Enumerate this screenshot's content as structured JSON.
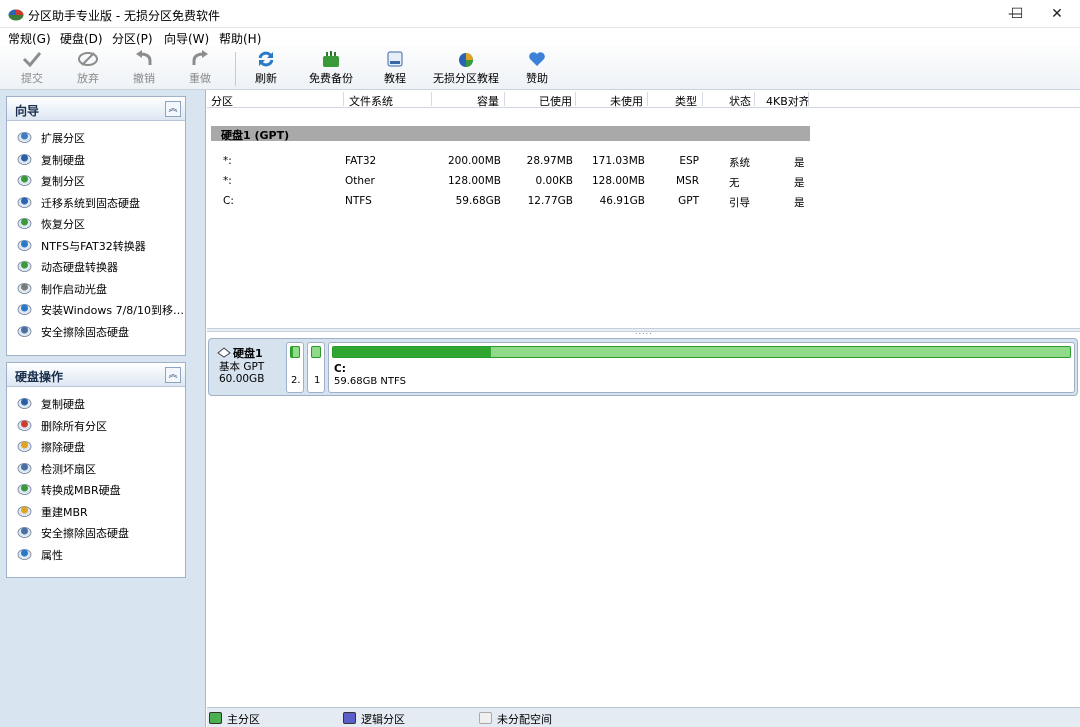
{
  "window": {
    "title": "分区助手专业版 - 无损分区免费软件",
    "minimize": "—",
    "maximize": "☐",
    "close": "✕"
  },
  "menu": [
    "常规(G)",
    "硬盘(D)",
    "分区(P)",
    "向导(W)",
    "帮助(H)"
  ],
  "toolbar": {
    "commit": "提交",
    "discard": "放弃",
    "undo": "撤销",
    "redo": "重做",
    "refresh": "刷新",
    "backup": "免费备份",
    "tutorial": "教程",
    "partition_tutorial": "无损分区教程",
    "donate": "赞助"
  },
  "wizard_panel": {
    "title": "向导",
    "items": [
      {
        "label": "扩展分区",
        "icon": "extend-partition-icon"
      },
      {
        "label": "复制硬盘",
        "icon": "copy-disk-icon"
      },
      {
        "label": "复制分区",
        "icon": "copy-partition-icon"
      },
      {
        "label": "迁移系统到固态硬盘",
        "icon": "migrate-os-icon"
      },
      {
        "label": "恢复分区",
        "icon": "recover-partition-icon"
      },
      {
        "label": "NTFS与FAT32转换器",
        "icon": "ntfs-fat32-icon"
      },
      {
        "label": "动态硬盘转换器",
        "icon": "dynamic-disk-icon"
      },
      {
        "label": "制作启动光盘",
        "icon": "bootable-media-icon"
      },
      {
        "label": "安装Windows 7/8/10到移…",
        "icon": "windows-to-go-icon"
      },
      {
        "label": "安全擦除固态硬盘",
        "icon": "ssd-erase-icon"
      }
    ]
  },
  "disk_ops_panel": {
    "title": "硬盘操作",
    "items": [
      {
        "label": "复制硬盘",
        "icon": "copy-disk-icon"
      },
      {
        "label": "删除所有分区",
        "icon": "delete-partitions-icon"
      },
      {
        "label": "擦除硬盘",
        "icon": "wipe-disk-icon"
      },
      {
        "label": "检测坏扇区",
        "icon": "bad-sector-icon"
      },
      {
        "label": "转换成MBR硬盘",
        "icon": "convert-mbr-icon"
      },
      {
        "label": "重建MBR",
        "icon": "rebuild-mbr-icon"
      },
      {
        "label": "安全擦除固态硬盘",
        "icon": "ssd-erase-icon"
      },
      {
        "label": "属性",
        "icon": "properties-icon"
      }
    ]
  },
  "table": {
    "headers": [
      "分区",
      "文件系统",
      "容量",
      "已使用",
      "未使用",
      "类型",
      "状态",
      "4KB对齐"
    ],
    "disk_label": "硬盘1 (GPT)",
    "rows": [
      [
        "*:",
        "FAT32",
        "200.00MB",
        "28.97MB",
        "171.03MB",
        "ESP",
        "系统",
        "是"
      ],
      [
        "*:",
        "Other",
        "128.00MB",
        "0.00KB",
        "128.00MB",
        "MSR",
        "无",
        "是"
      ],
      [
        "C:",
        "NTFS",
        "59.68GB",
        "12.77GB",
        "46.91GB",
        "GPT",
        "引导",
        "是"
      ]
    ]
  },
  "disk_map": {
    "name": "硬盘1",
    "type": "基本 GPT",
    "size": "60.00GB",
    "small_parts": [
      "2.",
      "1"
    ],
    "main_part": {
      "name": "C:",
      "desc": "59.68GB NTFS",
      "used_fraction": 0.214
    }
  },
  "legend": [
    {
      "label": "主分区",
      "color": "#4caf50"
    },
    {
      "label": "逻辑分区",
      "color": "#5b5fc7"
    },
    {
      "label": "未分配空间",
      "color": "#f0f0f0"
    }
  ],
  "splitter_grip": "....."
}
